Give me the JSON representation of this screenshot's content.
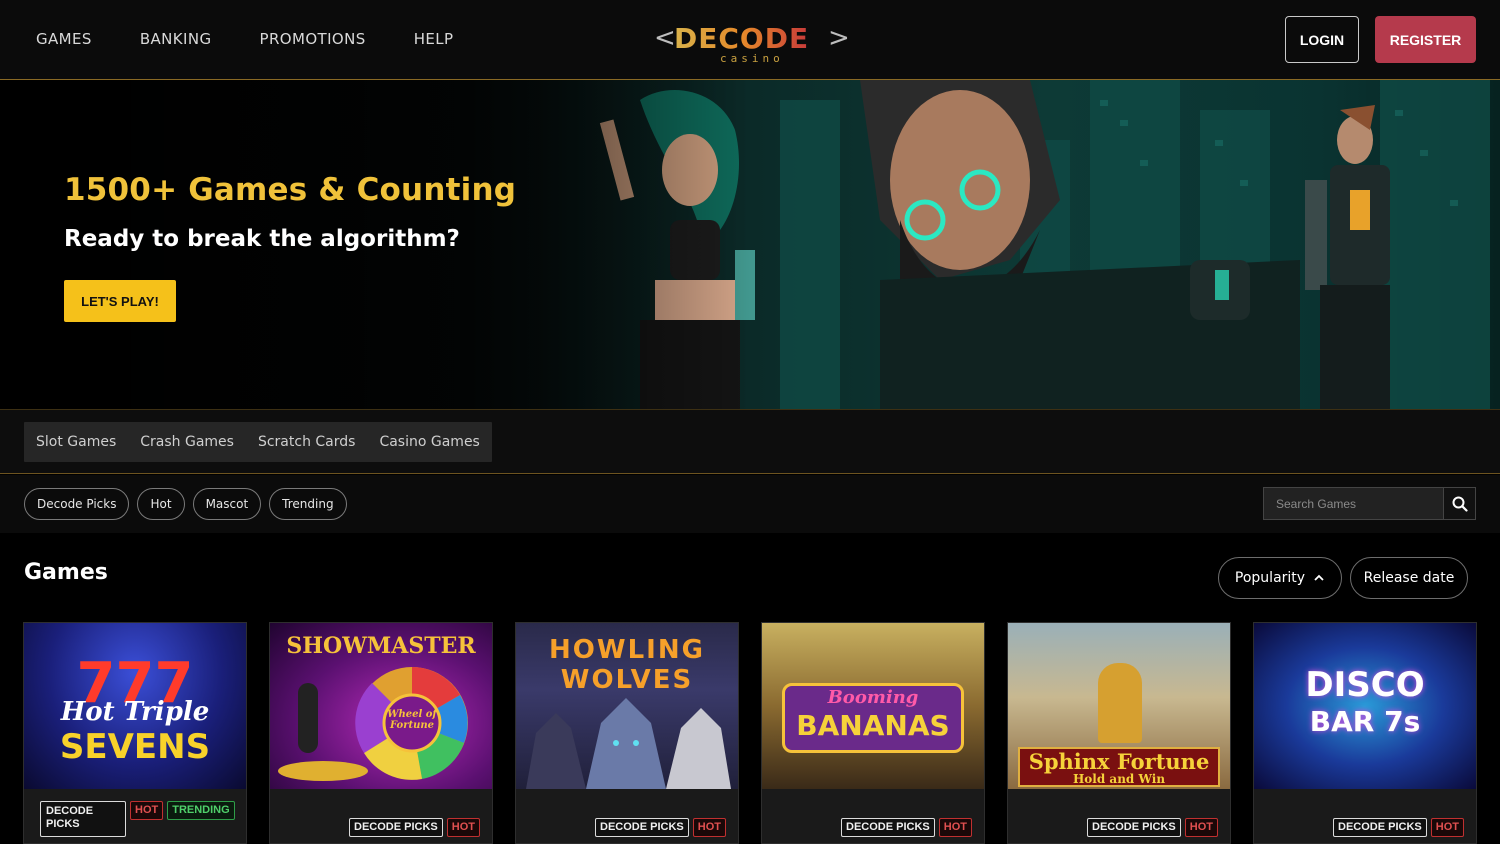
{
  "header": {
    "nav": [
      "GAMES",
      "BANKING",
      "PROMOTIONS",
      "HELP"
    ],
    "logo_text": "DECODE",
    "logo_sub": "casino",
    "login_label": "LOGIN",
    "register_label": "REGISTER"
  },
  "hero": {
    "title": "1500+ Games & Counting",
    "subtitle": "Ready to break the algorithm?",
    "cta_label": "LET'S PLAY!"
  },
  "categories": [
    "Slot Games",
    "Crash Games",
    "Scratch Cards",
    "Casino Games"
  ],
  "filters": [
    "Decode Picks",
    "Hot",
    "Mascot",
    "Trending"
  ],
  "search": {
    "placeholder": "Search Games",
    "icon": "search-icon"
  },
  "games_section": {
    "title": "Games",
    "sort_popularity": "Popularity",
    "sort_release": "Release date"
  },
  "games": [
    {
      "title_line1": "Hot Triple",
      "title_line2": "SEVENS",
      "tags": [
        "DECODE PICKS",
        "HOT",
        "TRENDING"
      ]
    },
    {
      "title_line1": "SHOWMASTER",
      "title_line2": "Wheel of Fortune",
      "tags": [
        "DECODE PICKS",
        "HOT"
      ]
    },
    {
      "title_line1": "HOWLING",
      "title_line2": "WOLVES",
      "tags": [
        "DECODE PICKS",
        "HOT"
      ]
    },
    {
      "title_line1": "Booming",
      "title_line2": "BANANAS",
      "tags": [
        "DECODE PICKS",
        "HOT"
      ]
    },
    {
      "title_line1": "Sphinx Fortune",
      "title_line2": "Hold and Win",
      "tags": [
        "DECODE PICKS",
        "HOT"
      ]
    },
    {
      "title_line1": "DISCO",
      "title_line2": "BAR 7s",
      "tags": [
        "DECODE PICKS",
        "HOT"
      ]
    }
  ],
  "colors": {
    "accent_gold": "#f0c23a",
    "cta_yellow": "#f5c11a",
    "register_red": "#b53a4c",
    "hot_red": "#e05050",
    "trending_green": "#4fcf6a"
  }
}
